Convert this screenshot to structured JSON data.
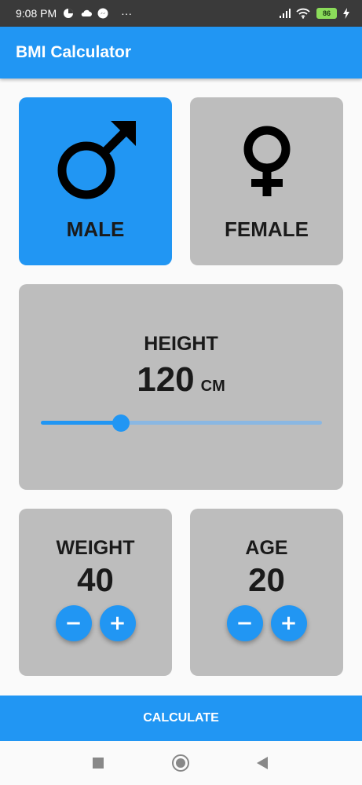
{
  "status_bar": {
    "time": "9:08 PM",
    "battery": "86",
    "more": "···"
  },
  "app_bar": {
    "title": "BMI Calculator"
  },
  "gender": {
    "male": {
      "label": "MALE",
      "selected": true,
      "icon": "male-symbol-icon"
    },
    "female": {
      "label": "FEMALE",
      "selected": false,
      "icon": "female-symbol-icon"
    }
  },
  "height": {
    "label": "HEIGHT",
    "value": "120",
    "unit": "CM",
    "slider_fraction": 0.285
  },
  "weight": {
    "label": "WEIGHT",
    "value": "40",
    "minus": "−",
    "plus": "+"
  },
  "age": {
    "label": "AGE",
    "value": "20",
    "minus": "−",
    "plus": "+"
  },
  "calculate": {
    "label": "CALCULATE"
  },
  "colors": {
    "primary": "#2196f3",
    "card_inactive": "#bdbdbd",
    "text": "#1a1a1a"
  }
}
